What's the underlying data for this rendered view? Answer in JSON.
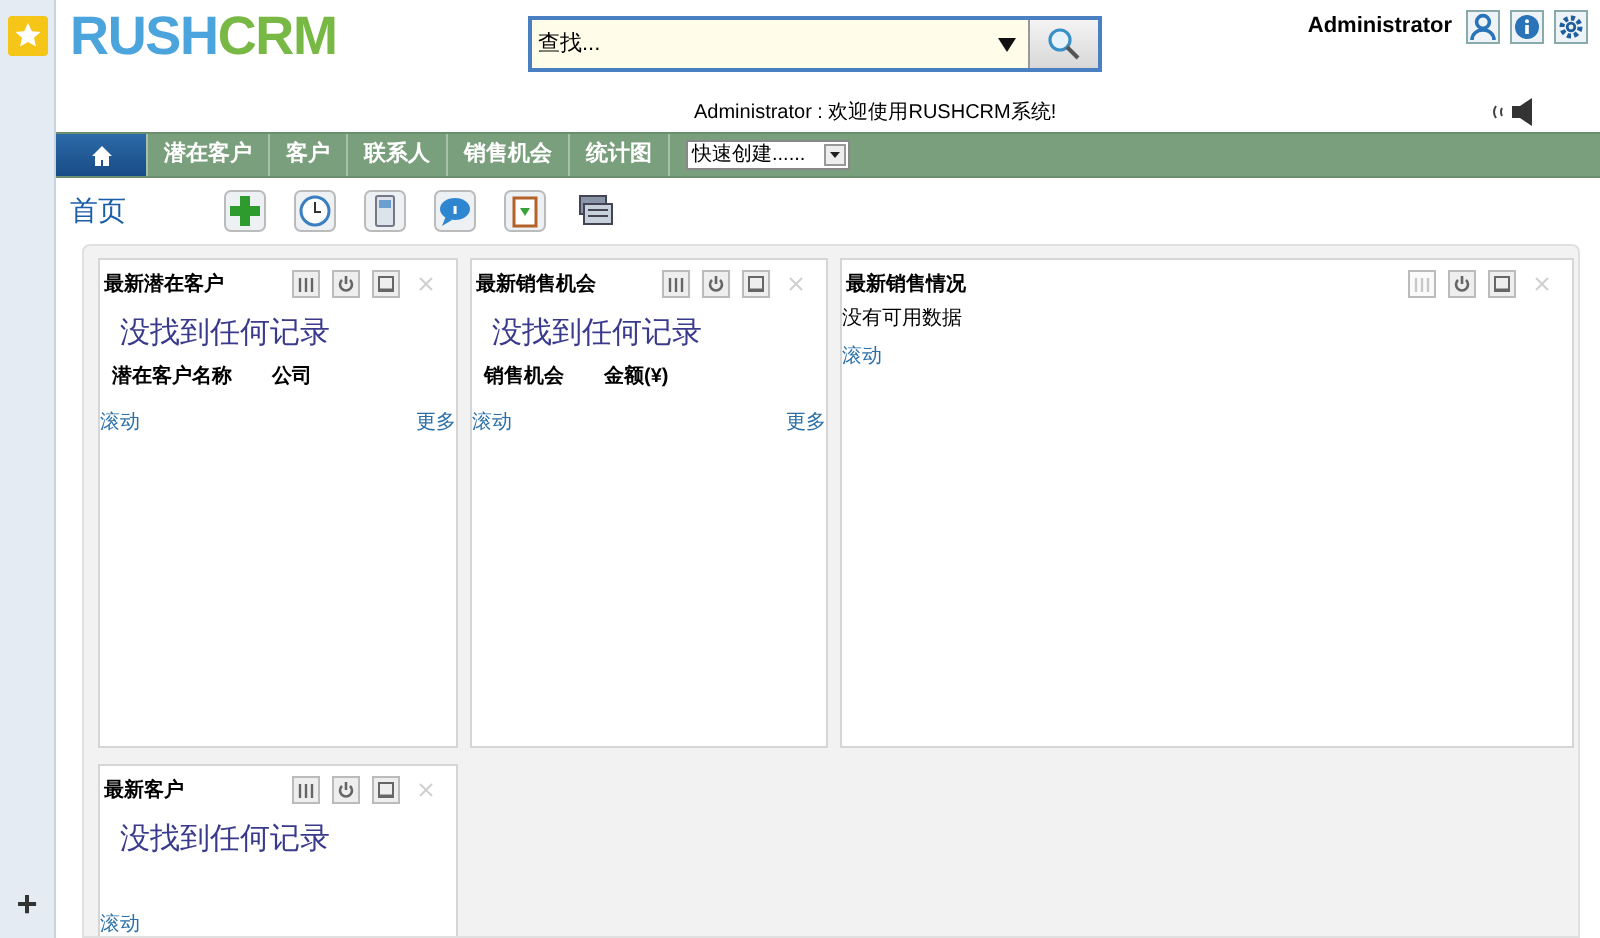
{
  "logo": {
    "part_1": "RUSH",
    "part_2": "CRM"
  },
  "search": {
    "placeholder": "查找..."
  },
  "user": {
    "name": "Administrator"
  },
  "welcome": "Administrator : 欢迎使用RUSHCRM系统!",
  "nav": {
    "tabs": [
      {
        "kind": "home",
        "selected": true
      },
      {
        "label": "潜在客户",
        "selected": false
      },
      {
        "label": "客户",
        "selected": false
      },
      {
        "label": "联系人",
        "selected": false
      },
      {
        "label": "销售机会",
        "selected": false
      },
      {
        "label": "统计图",
        "selected": false
      }
    ],
    "quick_create": {
      "value": "快速创建......"
    }
  },
  "page_title": "首页",
  "sidebar": {
    "add": "+"
  },
  "widgets": [
    {
      "title": "最新潜在客户",
      "kind": "list",
      "empty_text": "没找到任何记录",
      "columns": [
        "潜在客户名称",
        "公司"
      ],
      "scroll_link": "滚动",
      "more_link": "更多",
      "columns_control_disabled": false
    },
    {
      "title": "最新销售机会",
      "kind": "list",
      "empty_text": "没找到任何记录",
      "columns": [
        "销售机会",
        "金额(¥)"
      ],
      "scroll_link": "滚动",
      "more_link": "更多",
      "columns_control_disabled": false
    },
    {
      "title": "最新销售情况",
      "kind": "message",
      "empty_text": "没有可用数据",
      "scroll_link": "滚动",
      "columns_control_disabled": true
    },
    {
      "title": "最新客户",
      "kind": "list",
      "empty_text": "没找到任何记录",
      "scroll_link": "滚动",
      "columns_control_disabled": false
    }
  ]
}
